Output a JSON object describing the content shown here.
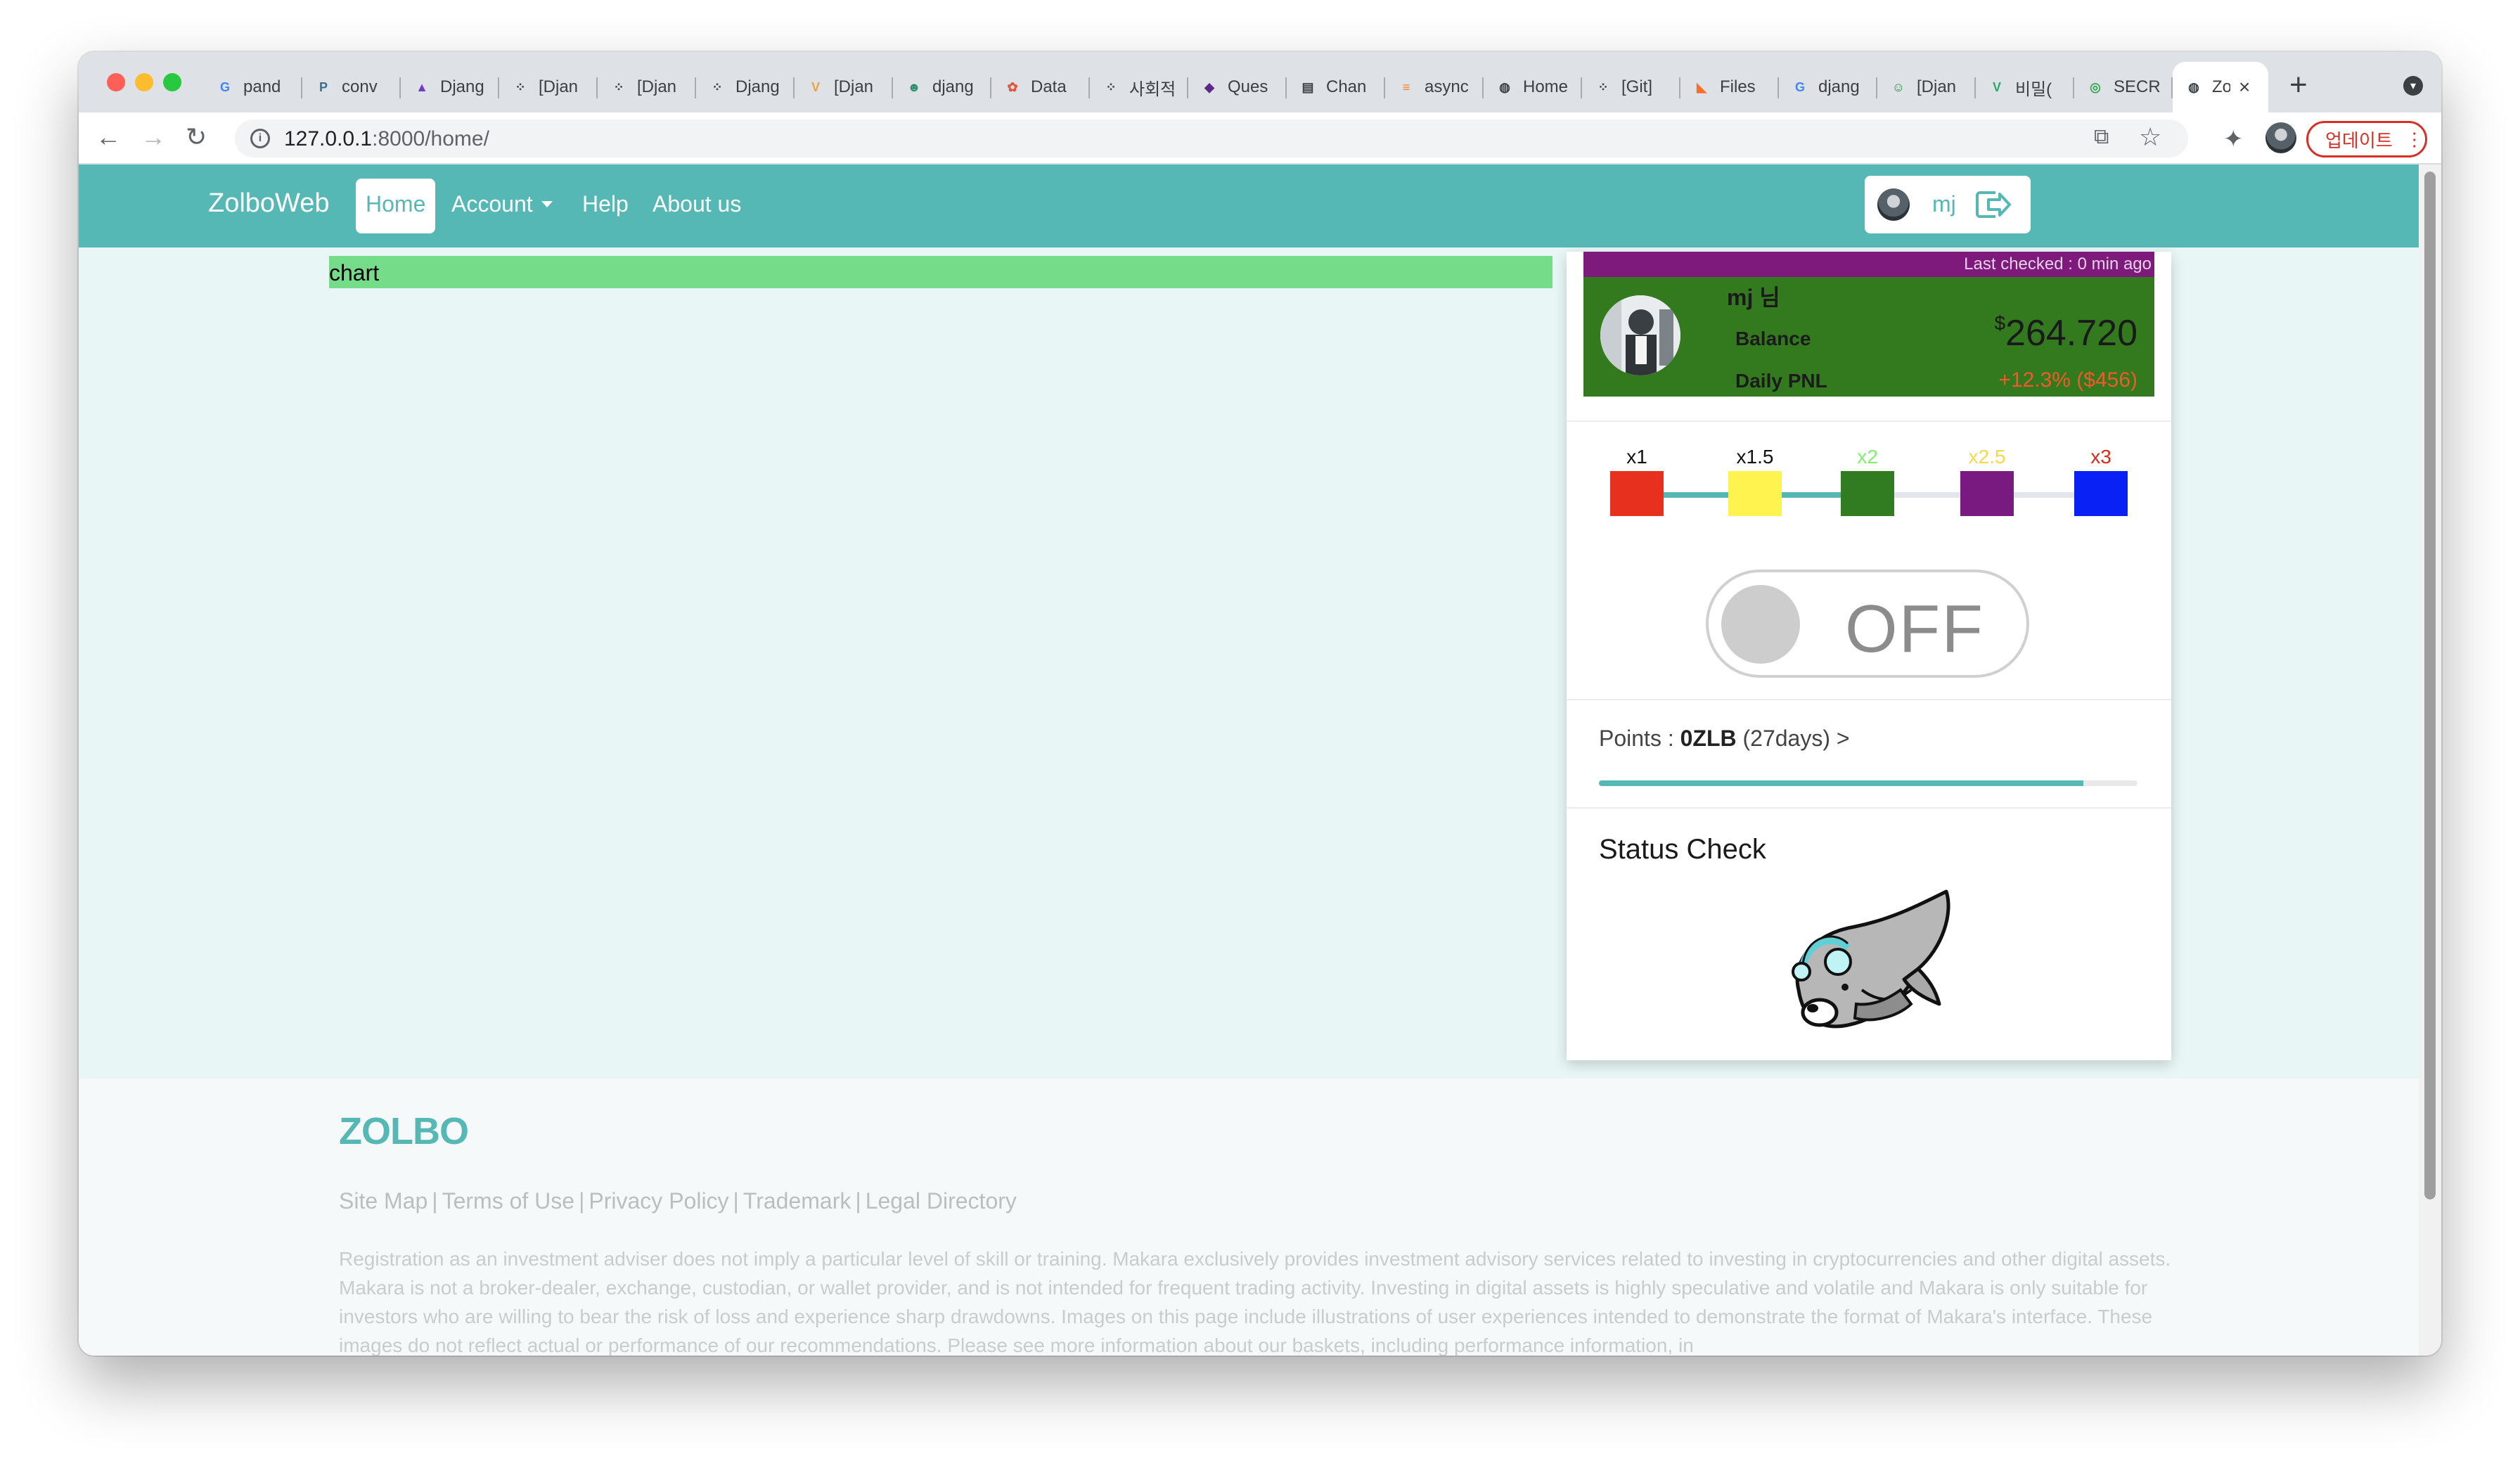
{
  "browser": {
    "tabs": [
      {
        "title": "pand",
        "icon": "google-icon",
        "color": "#4285f4",
        "glyph": "G"
      },
      {
        "title": "conv",
        "icon": "python-icon",
        "color": "#3a6f8f",
        "glyph": "P"
      },
      {
        "title": "Djang",
        "icon": "rocket-icon",
        "color": "#6e3fc6",
        "glyph": "▲"
      },
      {
        "title": "[Djan",
        "icon": "dots-icon",
        "color": "#3c4043",
        "glyph": "⁘"
      },
      {
        "title": "[Djan",
        "icon": "dots-icon",
        "color": "#3c4043",
        "glyph": "⁘"
      },
      {
        "title": "Djang",
        "icon": "dots-icon",
        "color": "#3c4043",
        "glyph": "⁘"
      },
      {
        "title": "[Djan",
        "icon": "v-icon",
        "color": "#e7a33e",
        "glyph": "V"
      },
      {
        "title": "djang",
        "icon": "sunglasses-icon",
        "color": "#2e8f6a",
        "glyph": "☻"
      },
      {
        "title": "Data",
        "icon": "flower-icon",
        "color": "#e2583e",
        "glyph": "✿"
      },
      {
        "title": "사회적",
        "icon": "dots-icon",
        "color": "#3c4043",
        "glyph": "⁘"
      },
      {
        "title": "Ques",
        "icon": "bird-icon",
        "color": "#5b2a86",
        "glyph": "◆"
      },
      {
        "title": "Chan",
        "icon": "doc-icon",
        "color": "#3c4043",
        "glyph": "▤"
      },
      {
        "title": "async",
        "icon": "stack-icon",
        "color": "#f48024",
        "glyph": "≡"
      },
      {
        "title": "Home",
        "icon": "globe-icon",
        "color": "#3c4043",
        "glyph": "◍"
      },
      {
        "title": "[Git]",
        "icon": "dots-icon",
        "color": "#3c4043",
        "glyph": "⁘"
      },
      {
        "title": "Files",
        "icon": "gitlab-icon",
        "color": "#fc6d26",
        "glyph": "◣"
      },
      {
        "title": "djang",
        "icon": "google-icon",
        "color": "#4285f4",
        "glyph": "G"
      },
      {
        "title": "[Djan",
        "icon": "face-icon",
        "color": "#2f8f3a",
        "glyph": "☺"
      },
      {
        "title": "비밀(",
        "icon": "v-square-icon",
        "color": "#2fa86b",
        "glyph": "V"
      },
      {
        "title": "SECR",
        "icon": "shield-icon",
        "color": "#34a853",
        "glyph": "◎"
      }
    ],
    "active_tab": {
      "title": "Zo",
      "icon": "globe-icon"
    },
    "new_tab": "+",
    "url_host": "127.0.0.1",
    "url_path": ":8000/home/",
    "update_label": "업데이트"
  },
  "navbar": {
    "brand": "ZolboWeb",
    "home": "Home",
    "account": "Account",
    "help": "Help",
    "about": "About us",
    "username": "mj"
  },
  "main": {
    "chart_placeholder": "chart"
  },
  "account_card": {
    "last_checked": "Last checked : 0 min ago",
    "name": "mj 님",
    "balance_label": "Balance",
    "balance_currency": "$",
    "balance_value": "264.720",
    "pnl_label": "Daily PNL",
    "pnl_value": "+12.3% ($456)",
    "header_color": "#337a1e",
    "strip_color": "#7d1a7c",
    "pnl_color": "#f2592a"
  },
  "leverage": {
    "options": [
      {
        "label": "x1",
        "label_color": "#111111",
        "box_color": "#e8301f"
      },
      {
        "label": "x1.5",
        "label_color": "#111111",
        "box_color": "#fff44f"
      },
      {
        "label": "x2",
        "label_color": "#7ef06a",
        "box_color": "#317b21"
      },
      {
        "label": "x2.5",
        "label_color": "#f6d84a",
        "box_color": "#781a7f"
      },
      {
        "label": "x3",
        "label_color": "#d92a1a",
        "box_color": "#0a21f5"
      }
    ],
    "selected": "x2",
    "track_active_color": "#56b8b4",
    "track_inactive_color": "#e3e6ec"
  },
  "toggle": {
    "label": "OFF",
    "state": "off"
  },
  "points": {
    "prefix": "Points : ",
    "value": "0ZLB",
    "suffix": " (27days) >",
    "progress_percent": 90
  },
  "status": {
    "title": "Status Check",
    "mascot": "whale-mascot-icon"
  },
  "footer": {
    "logo": "ZOLBO",
    "links": [
      "Site Map",
      "Terms of Use",
      "Privacy Policy",
      "Trademark",
      "Legal Directory"
    ],
    "disclaimer": "Registration as an investment adviser does not imply a particular level of skill or training. Makara exclusively provides investment advisory services related to investing in cryptocurrencies and other digital assets. Makara is not a broker-dealer, exchange, custodian, or wallet provider, and is not intended for frequent trading activity. Investing in digital assets is highly speculative and volatile and Makara is only suitable for investors who are willing to bear the risk of loss and experience sharp drawdowns. Images on this page include illustrations of user experiences intended to demonstrate the format of Makara's interface. These images do not reflect actual or performance of our recommendations. Please see more information about our baskets, including performance information, in"
  },
  "colors": {
    "accent": "#56b8b4",
    "page_bg": "#e8f6f5",
    "chart_bar": "#75dd8a"
  }
}
